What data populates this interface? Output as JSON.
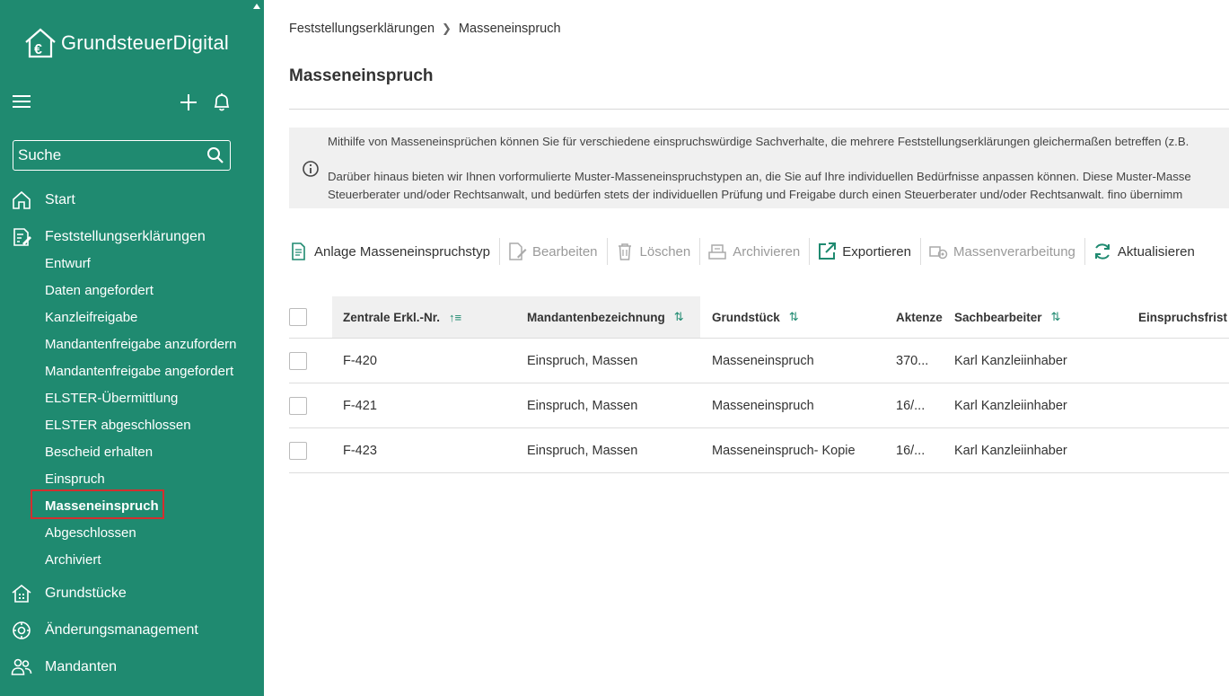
{
  "app": {
    "brand": "GrundsteuerDigital",
    "accent": "#1f8a70",
    "highlight": "#d32f2f"
  },
  "search": {
    "placeholder": "Suche"
  },
  "nav": {
    "start": "Start",
    "feststellung": "Feststellungserklärungen",
    "sub": [
      "Entwurf",
      "Daten angefordert",
      "Kanzleifreigabe",
      "Mandantenfreigabe anzufordern",
      "Mandantenfreigabe angefordert",
      "ELSTER-Übermittlung",
      "ELSTER abgeschlossen",
      "Bescheid erhalten",
      "Einspruch",
      "Masseneinspruch",
      "Abgeschlossen",
      "Archiviert"
    ],
    "grundstuecke": "Grundstücke",
    "aenderung": "Änderungsmanagement",
    "mandanten": "Mandanten"
  },
  "breadcrumb": {
    "parent": "Feststellungserklärungen",
    "current": "Masseneinspruch"
  },
  "page": {
    "title": "Masseneinspruch"
  },
  "info": {
    "line1": "Mithilfe von Masseneinsprüchen können Sie für verschiedene einspruchswürdige Sachverhalte, die mehrere Feststellungserklärungen gleichermaßen betreffen (z.B.",
    "line2": "Darüber hinaus bieten wir Ihnen vorformulierte Muster-Masseneinspruchstypen an, die Sie auf Ihre individuellen Bedürfnisse anpassen können. Diese Muster-Masse",
    "line3": "Steuerberater und/oder Rechtsanwalt, und bedürfen stets der individuellen Prüfung und Freigabe durch einen Steuerberater und/oder Rechtsanwalt. fino übernimm"
  },
  "toolbar": {
    "anlage": "Anlage Masseneinspruchstyp",
    "bearbeiten": "Bearbeiten",
    "loeschen": "Löschen",
    "archivieren": "Archivieren",
    "exportieren": "Exportieren",
    "massenverarbeitung": "Massenverarbeitung",
    "aktualisieren": "Aktualisieren"
  },
  "table": {
    "headers": {
      "nr": "Zentrale Erkl.-Nr.",
      "mandant": "Mandantenbezeichnung",
      "grundstueck": "Grundstück",
      "akte": "Aktenze",
      "sachbearbeiter": "Sachbearbeiter",
      "frist": "Einspruchsfrist"
    },
    "rows": [
      {
        "nr": "F-420",
        "mandant": "Einspruch, Massen",
        "grundstueck": "Masseneinspruch",
        "akte": "370...",
        "sachbearbeiter": "Karl Kanzleiinhaber"
      },
      {
        "nr": "F-421",
        "mandant": "Einspruch, Massen",
        "grundstueck": "Masseneinspruch",
        "akte": "16/...",
        "sachbearbeiter": "Karl Kanzleiinhaber"
      },
      {
        "nr": "F-423",
        "mandant": "Einspruch, Massen",
        "grundstueck": "Masseneinspruch- Kopie",
        "akte": "16/...",
        "sachbearbeiter": "Karl Kanzleiinhaber"
      }
    ]
  }
}
